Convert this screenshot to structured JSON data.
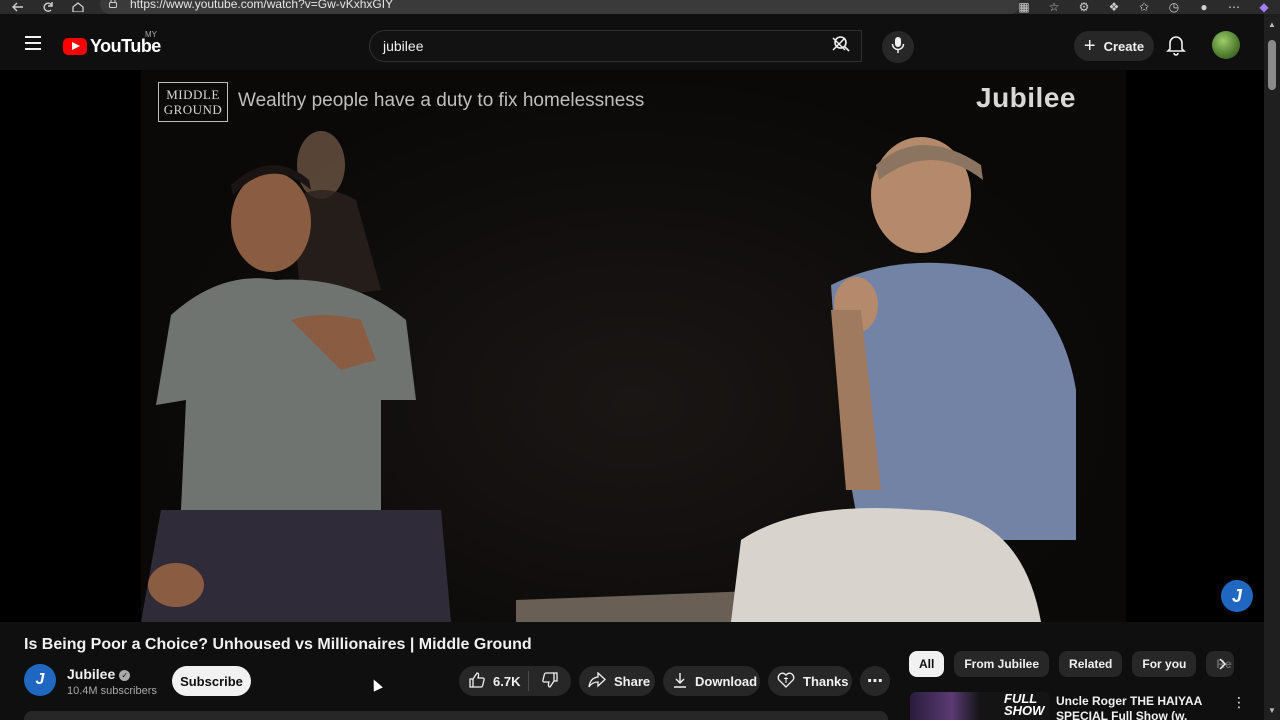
{
  "browser": {
    "url": "https://www.youtube.com/watch?v=Gw-vKxhxGIY"
  },
  "header": {
    "logo_text": "YouTube",
    "country_code": "MY",
    "search_value": "jubilee",
    "create_label": "Create"
  },
  "player": {
    "overlay_brand": "MIDDLE GROUND",
    "overlay_brand_line1": "MIDDLE",
    "overlay_brand_line2": "GROUND",
    "overlay_statement": "Wealthy people have a duty to fix homelessness",
    "channel_watermark": "Jubilee"
  },
  "video": {
    "title": "Is Being Poor a Choice? Unhoused vs Millionaires | Middle Ground",
    "channel_name": "Jubilee",
    "subscribers": "10.4M subscribers",
    "subscribe_label": "Subscribe",
    "like_count": "6.7K",
    "share_label": "Share",
    "download_label": "Download",
    "thanks_label": "Thanks"
  },
  "chips": {
    "items": [
      {
        "label": "All",
        "active": true
      },
      {
        "label": "From Jubilee",
        "active": false
      },
      {
        "label": "Related",
        "active": false
      },
      {
        "label": "For you",
        "active": false
      },
      {
        "label": "Re",
        "active": false
      }
    ]
  },
  "recommendations": [
    {
      "thumb_text_line1": "FULL",
      "thumb_text_line2": "SHOW",
      "title": "Uncle Roger THE HAIYAA SPECIAL Full Show (w. Nigel"
    }
  ],
  "colors": {
    "background": "#0f0f0f",
    "surface": "#272727",
    "youtube_red": "#ff0000",
    "jubilee_blue": "#1f67c0",
    "text_primary": "#f1f1f1",
    "text_secondary": "#aaaaaa"
  },
  "icons": [
    "back-icon",
    "refresh-icon",
    "home-icon",
    "lock-icon",
    "menu-icon",
    "youtube-play-icon",
    "clear-icon",
    "search-icon",
    "mic-icon",
    "plus-icon",
    "bell-icon",
    "verified-icon",
    "thumbs-up-icon",
    "thumbs-down-icon",
    "share-icon",
    "download-icon",
    "thanks-icon",
    "more-icon",
    "chevron-right-icon",
    "kebab-icon"
  ]
}
